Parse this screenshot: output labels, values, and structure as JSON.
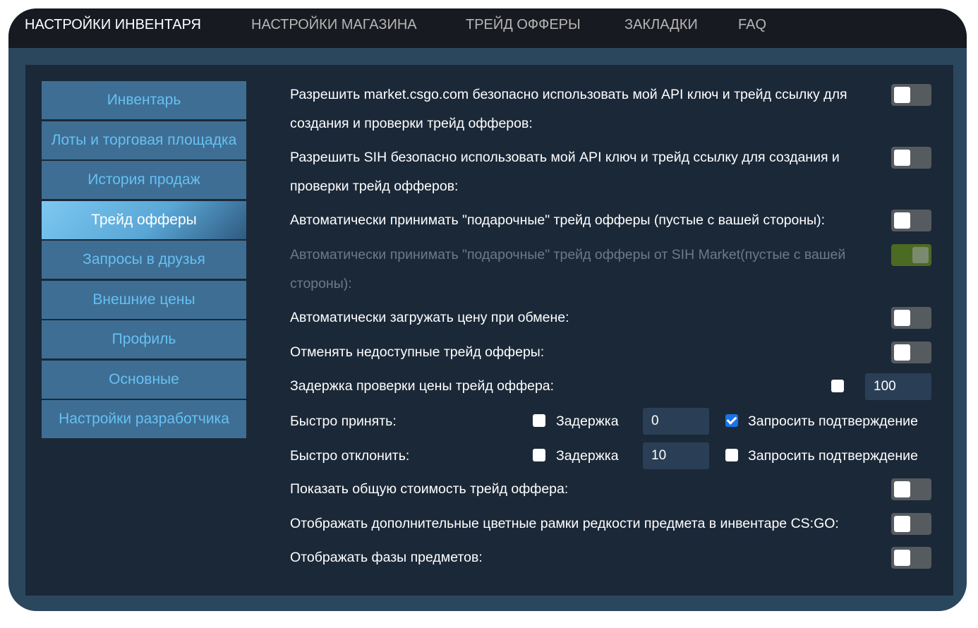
{
  "nav": {
    "tabs": [
      {
        "label": "НАСТРОЙКИ ИНВЕНТАРЯ",
        "active": true
      },
      {
        "label": "НАСТРОЙКИ МАГАЗИНА"
      },
      {
        "label": "ТРЕЙД ОФФЕРЫ"
      },
      {
        "label": "ЗАКЛАДКИ"
      },
      {
        "label": "FAQ"
      }
    ]
  },
  "sidebar": {
    "items": [
      {
        "label": "Инвентарь"
      },
      {
        "label": "Лоты и торговая площадка"
      },
      {
        "label": "История продаж"
      },
      {
        "label": "Трейд офферы",
        "active": true
      },
      {
        "label": "Запросы в друзья"
      },
      {
        "label": "Внешние цены"
      },
      {
        "label": "Профиль"
      },
      {
        "label": "Основные"
      },
      {
        "label": "Настройки разработчика"
      }
    ]
  },
  "settings": {
    "allow_market": {
      "label": "Разрешить market.csgo.com безопасно использовать мой API ключ и трейд ссылку для создания и проверки трейд офферов:",
      "enabled": false
    },
    "allow_sih": {
      "label": "Разрешить SIH безопасно использовать мой API ключ и трейд ссылку для создания и проверки трейд офферов:",
      "enabled": false
    },
    "auto_accept_gifts": {
      "label": "Автоматически принимать \"подарочные\" трейд офферы (пустые с вашей стороны):",
      "enabled": false
    },
    "auto_accept_sih": {
      "label": "Автоматически принимать \"подарочные\" трейд офферы от SIH Market(пустые с вашей стороны):",
      "enabled": true,
      "disabled": true
    },
    "auto_load_price": {
      "label": "Автоматически загружать цену при обмене:",
      "enabled": false
    },
    "cancel_unavailable": {
      "label": "Отменять недоступные трейд офферы:",
      "enabled": false
    },
    "price_check_delay": {
      "label": "Задержка проверки цены трейд оффера:",
      "checked": false,
      "value": "100"
    },
    "quick_accept": {
      "label": "Быстро принять:",
      "delay_label": "Задержка",
      "delay_checked": false,
      "delay_value": "0",
      "confirm_label": "Запросить подтверждение",
      "confirm_checked": true
    },
    "quick_decline": {
      "label": "Быстро отклонить:",
      "delay_label": "Задержка",
      "delay_checked": false,
      "delay_value": "10",
      "confirm_label": "Запросить подтверждение",
      "confirm_checked": false
    },
    "show_total_value": {
      "label": "Показать общую стоимость трейд оффера:",
      "enabled": false
    },
    "rarity_borders": {
      "label": "Отображать дополнительные цветные рамки редкости предмета в инвентаре CS:GO:",
      "enabled": false
    },
    "item_phases": {
      "label": "Отображать фазы предметов:",
      "enabled": false
    }
  }
}
